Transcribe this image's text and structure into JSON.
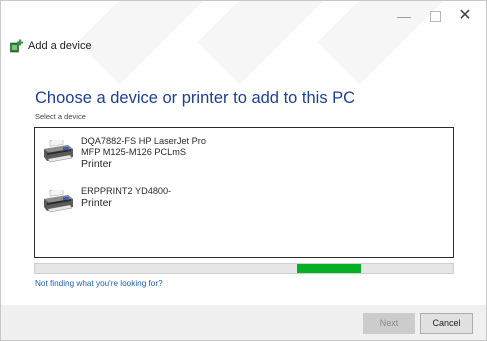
{
  "window": {
    "minimize_glyph": "—",
    "close_glyph": "✕"
  },
  "header": {
    "title": "Add a device",
    "icon": "add-device-icon"
  },
  "main": {
    "heading": "Choose a device or printer to add to this PC",
    "sub_label": "Select a device"
  },
  "devices": [
    {
      "name_line1": "DQA7882-FS  HP LaserJet Pro",
      "name_line2": "MFP M125-M126 PCLmS",
      "type": "Printer",
      "icon": "printer-icon"
    },
    {
      "name_line1": "ERPPRINT2  YD4800-",
      "type": "Printer",
      "icon": "printer-icon"
    }
  ],
  "progress": {
    "state": "indeterminate",
    "color": "#06b025"
  },
  "help_link": "Not finding what you're looking for?",
  "footer": {
    "next_label": "Next",
    "cancel_label": "Cancel",
    "next_enabled": false
  },
  "colors": {
    "heading": "#1f3f8f",
    "link": "#1f5fb0",
    "progress": "#06b025"
  }
}
